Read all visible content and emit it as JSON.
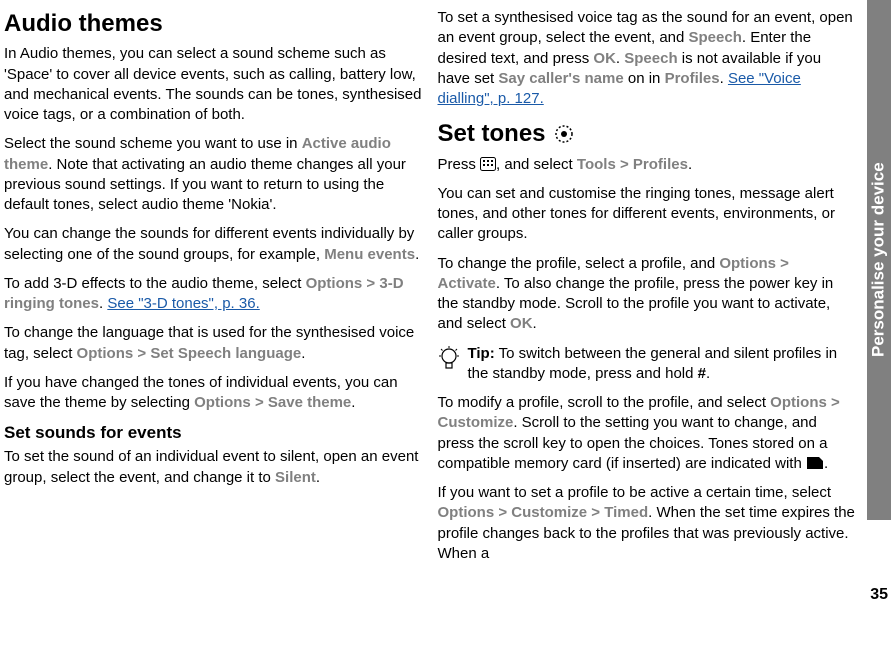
{
  "tab_label": "Personalise your device",
  "page_number": "35",
  "col1": {
    "heading": "Audio themes",
    "p1a": "In Audio themes, you can select a sound scheme such as 'Space' to cover all device events, such as calling, battery low, and mechanical events. The sounds can be tones, synthesised voice tags, or a combination of both.",
    "p2a": "Select the sound scheme you want to use in ",
    "p2b": "Active audio theme",
    "p2c": ". Note that activating an audio theme changes all your previous sound settings. If you want to return to using the default tones, select audio theme 'Nokia'.",
    "p3a": "You can change the sounds for different events individually by selecting one of the sound groups, for example, ",
    "p3b": "Menu events",
    "p3c": ".",
    "p4a": "To add 3-D effects to the audio theme, select ",
    "p4b": "Options",
    "p4c": " > ",
    "p4d": "3-D ringing tones",
    "p4e": ". ",
    "p4link": "See \"3-D tones\", p. 36.",
    "p5a": "To change the language that is used for the synthesised voice tag, select ",
    "p5b": "Options",
    "p5c": " > ",
    "p5d": "Set Speech language",
    "p5e": ".",
    "p6a": "If you have changed the tones of individual events, you can save the theme by selecting ",
    "p6b": "Options",
    "p6c": " > ",
    "p6d": "Save theme",
    "p6e": ".",
    "sub1": "Set sounds for events",
    "p7a": "To set the sound of an individual event to silent, open an event group, select the event, and change it to ",
    "p7b": "Silent",
    "p7c": "."
  },
  "col2": {
    "p1a": "To set a synthesised voice tag as the sound for an event, open an event group, select the event, and ",
    "p1b": "Speech",
    "p1c": ". Enter the desired text, and press ",
    "p1d": "OK",
    "p1e": ". ",
    "p1f": "Speech",
    "p1g": " is not available if you have set ",
    "p1h": "Say caller's name",
    "p1i": " on in ",
    "p1j": "Profiles",
    "p1k": ". ",
    "p1link": "See \"Voice dialling\", p. 127.",
    "heading": "Set tones",
    "p2a": "Press ",
    "p2b": ", and select ",
    "p2c": "Tools",
    "p2d": " > ",
    "p2e": "Profiles",
    "p2f": ".",
    "p3": "You can set and customise the ringing tones, message alert tones, and other tones for different events, environments, or caller groups.",
    "p4a": "To change the profile, select a profile, and ",
    "p4b": "Options",
    "p4c": " > ",
    "p4d": "Activate",
    "p4e": ". To also change the profile, press the power key in the standby mode. Scroll to the profile you want to activate, and select ",
    "p4f": "OK",
    "p4g": ".",
    "tip_label": "Tip:",
    "tip_text": " To switch between the general and silent profiles in the standby mode, press and hold ",
    "tip_key": "#",
    "tip_end": ".",
    "p5a": "To modify a profile, scroll to the profile, and select ",
    "p5b": "Options",
    "p5c": " > ",
    "p5d": "Customize",
    "p5e": ". Scroll to the setting you want to change, and press the scroll key to open the choices. Tones stored on a compatible memory card (if inserted) are indicated with ",
    "p5f": ".",
    "p6a": "If you want to set a profile to be active a certain time, select ",
    "p6b": "Options",
    "p6c": " > ",
    "p6d": "Customize",
    "p6e": " > ",
    "p6f": "Timed",
    "p6g": ". When the set time expires the profile changes back to the profiles that was previously active. When a"
  }
}
